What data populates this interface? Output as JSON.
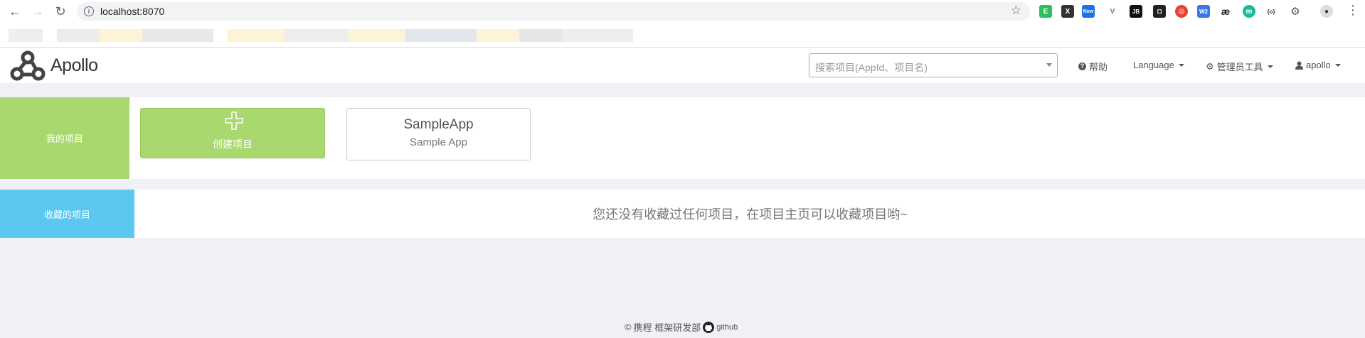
{
  "browser": {
    "url": "localhost:8070"
  },
  "header": {
    "logo_text": "Apollo",
    "search_placeholder": "搜索项目(AppId、项目名)",
    "nav": {
      "help": "帮助",
      "language": "Language",
      "admin_tools": "管理员工具",
      "user": "apollo"
    }
  },
  "my_projects": {
    "label": "我的项目",
    "create_label": "创建项目",
    "apps": [
      {
        "name": "SampleApp",
        "description": "Sample App"
      }
    ]
  },
  "favorites": {
    "label": "收藏的项目",
    "empty_message": "您还没有收藏过任何项目，在项目主页可以收藏项目哟~"
  },
  "footer": {
    "company": "携程 框架研发部",
    "github": "github"
  },
  "colors": {
    "my_projects_label": "#a9d86e",
    "favorites_label": "#5bc8f0",
    "page_bg": "#f0f0f5"
  }
}
